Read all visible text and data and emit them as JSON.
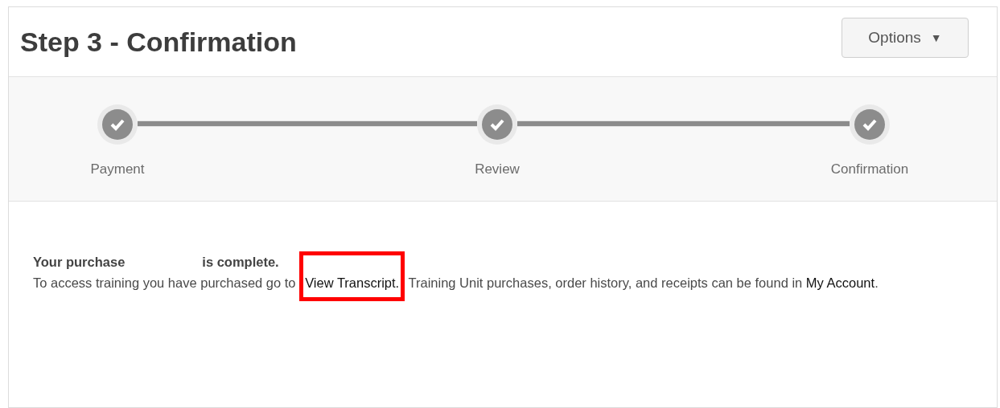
{
  "header": {
    "title": "Step 3 - Confirmation",
    "options_button": {
      "label": "Options",
      "caret": "▼"
    }
  },
  "steps": [
    {
      "label": "Payment",
      "completed": true
    },
    {
      "label": "Review",
      "completed": true
    },
    {
      "label": "Confirmation",
      "completed": true
    }
  ],
  "message": {
    "heading": [
      "Your purchase",
      "is complete."
    ],
    "body": [
      {
        "kind": "text",
        "text": "To access training you have purchased go to "
      },
      {
        "kind": "link",
        "text": "View Transcript.",
        "highlighted": true
      },
      {
        "kind": "text",
        "text": " Training Unit purchases, order history, and receipts can be found in "
      },
      {
        "kind": "link",
        "text": "My Account",
        "highlighted": false
      },
      {
        "kind": "text",
        "text": "."
      }
    ]
  }
}
